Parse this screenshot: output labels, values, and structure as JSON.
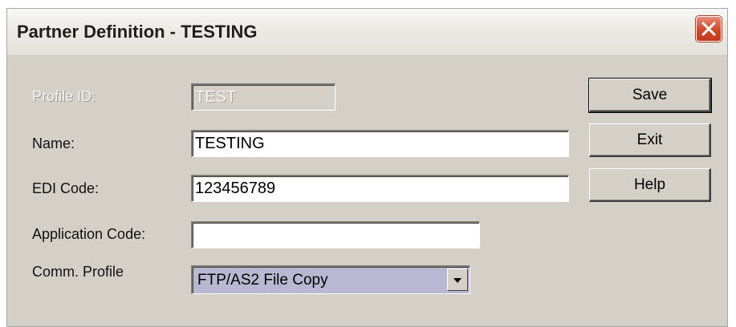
{
  "window": {
    "title": "Partner Definition - TESTING",
    "close_icon": "close-icon"
  },
  "form": {
    "profile_id": {
      "label": "Profile ID:",
      "value": "TEST",
      "disabled": true
    },
    "name": {
      "label": "Name:",
      "value": "TESTING"
    },
    "edi_code": {
      "label": "EDI Code:",
      "value": "123456789"
    },
    "application_code": {
      "label": "Application Code:",
      "value": ""
    },
    "comm_profile": {
      "label": "Comm. Profile",
      "value": "FTP/AS2 File Copy"
    }
  },
  "buttons": {
    "save": "Save",
    "exit": "Exit",
    "help": "Help"
  },
  "colors": {
    "dialog_bg": "#d4d0c8",
    "close_red": "#d2472b",
    "select_highlight": "#b9b8d2"
  }
}
